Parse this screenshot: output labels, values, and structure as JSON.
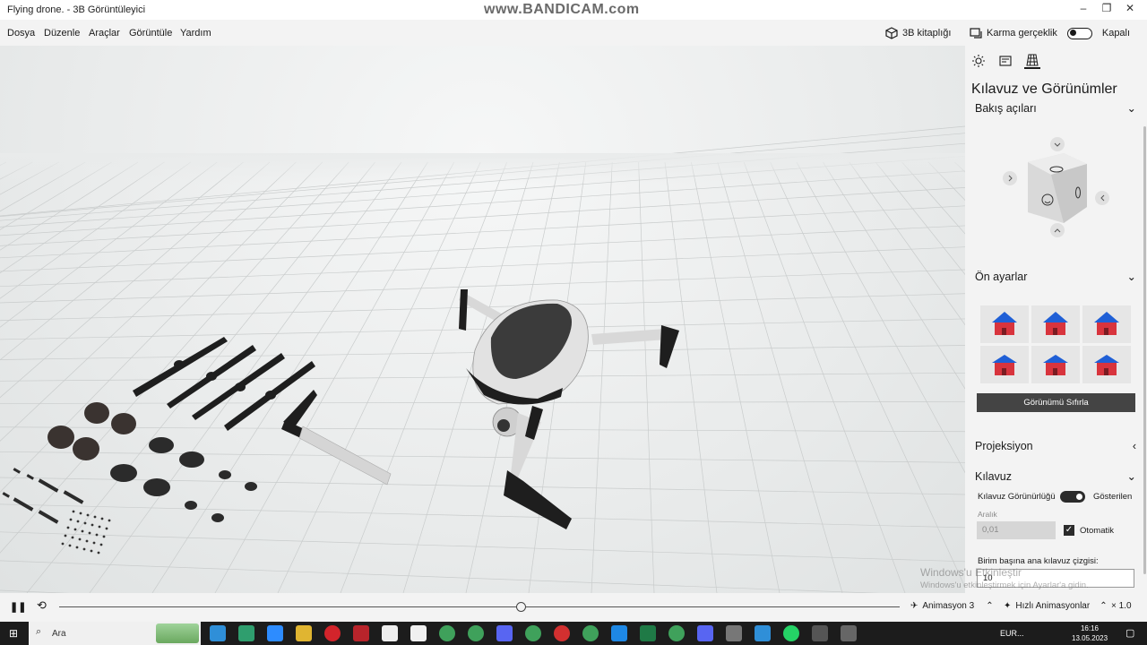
{
  "window": {
    "title": "Flying drone. - 3B Görüntüleyici",
    "watermark": "www.BANDICAM.com",
    "controls": [
      "–",
      "❐",
      "✕"
    ]
  },
  "menu": {
    "items": [
      "Dosya",
      "Düzenle",
      "Araçlar",
      "Görüntüle",
      "Yardım"
    ],
    "library_label": "3B kitaplığı",
    "mixed_reality_label": "Karma gerçeklik",
    "mixed_reality_state": "Kapalı"
  },
  "panel": {
    "title": "Kılavuz ve Görünümler",
    "sections": {
      "view_angles": "Bakış açıları",
      "presets": "Ön ayarlar",
      "projection": "Projeksiyon",
      "grid": "Kılavuz"
    },
    "reset_view_label": "Görünümü Sıfırla",
    "grid_visibility_label": "Kılavuz Görünürlüğü",
    "grid_visibility_state": "Gösterilen",
    "spacing_label": "Aralık",
    "spacing_value": "0,01",
    "auto_label": "Otomatik",
    "auto_checked": true,
    "units_label": "Birim başına ana kılavuz çizgisi:",
    "units_value": "10"
  },
  "activation": {
    "title": "Windows'u Etkinleştir",
    "subtitle": "Windows'u etkinleştirmek için Ayarlar'a gidin."
  },
  "timeline": {
    "progress": 0.55,
    "animation_label": "Animasyon 3",
    "quick_animations_label": "Hızlı Animasyonlar",
    "speed_label": "× 1.0"
  },
  "taskbar": {
    "search_placeholder": "Ara",
    "currency": "EUR...",
    "time": "16:16",
    "date": "13.05.2023"
  },
  "colors": {
    "accent": "#2b2b2b",
    "house_roof": "#1f5fd6",
    "house_wall": "#d8343d",
    "taskbar": "#1c1c1c"
  }
}
